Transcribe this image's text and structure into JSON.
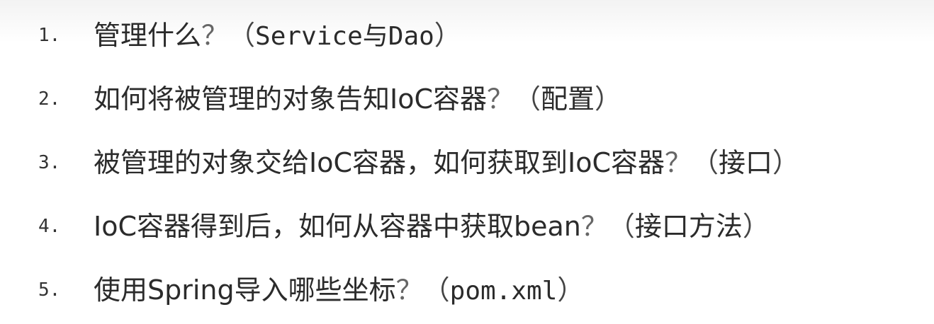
{
  "items": [
    {
      "number": "1.",
      "question": "管理什么",
      "qmark": "？",
      "open": "（",
      "answer": "Service与Dao",
      "close": "）"
    },
    {
      "number": "2.",
      "question": "如何将被管理的对象告知IoC容器",
      "qmark": "？",
      "open": "（",
      "answer": "配置",
      "close": "）"
    },
    {
      "number": "3.",
      "question": "被管理的对象交给IoC容器，如何获取到IoC容器",
      "qmark": "？",
      "open": "（",
      "answer": "接口",
      "close": "）"
    },
    {
      "number": "4.",
      "question": "IoC容器得到后，如何从容器中获取bean",
      "qmark": "？",
      "open": "（",
      "answer": "接口方法",
      "close": "）"
    },
    {
      "number": "5.",
      "question": "使用Spring导入哪些坐标",
      "qmark": "？",
      "open": "（",
      "answer": "pom.xml",
      "close": "）"
    }
  ]
}
